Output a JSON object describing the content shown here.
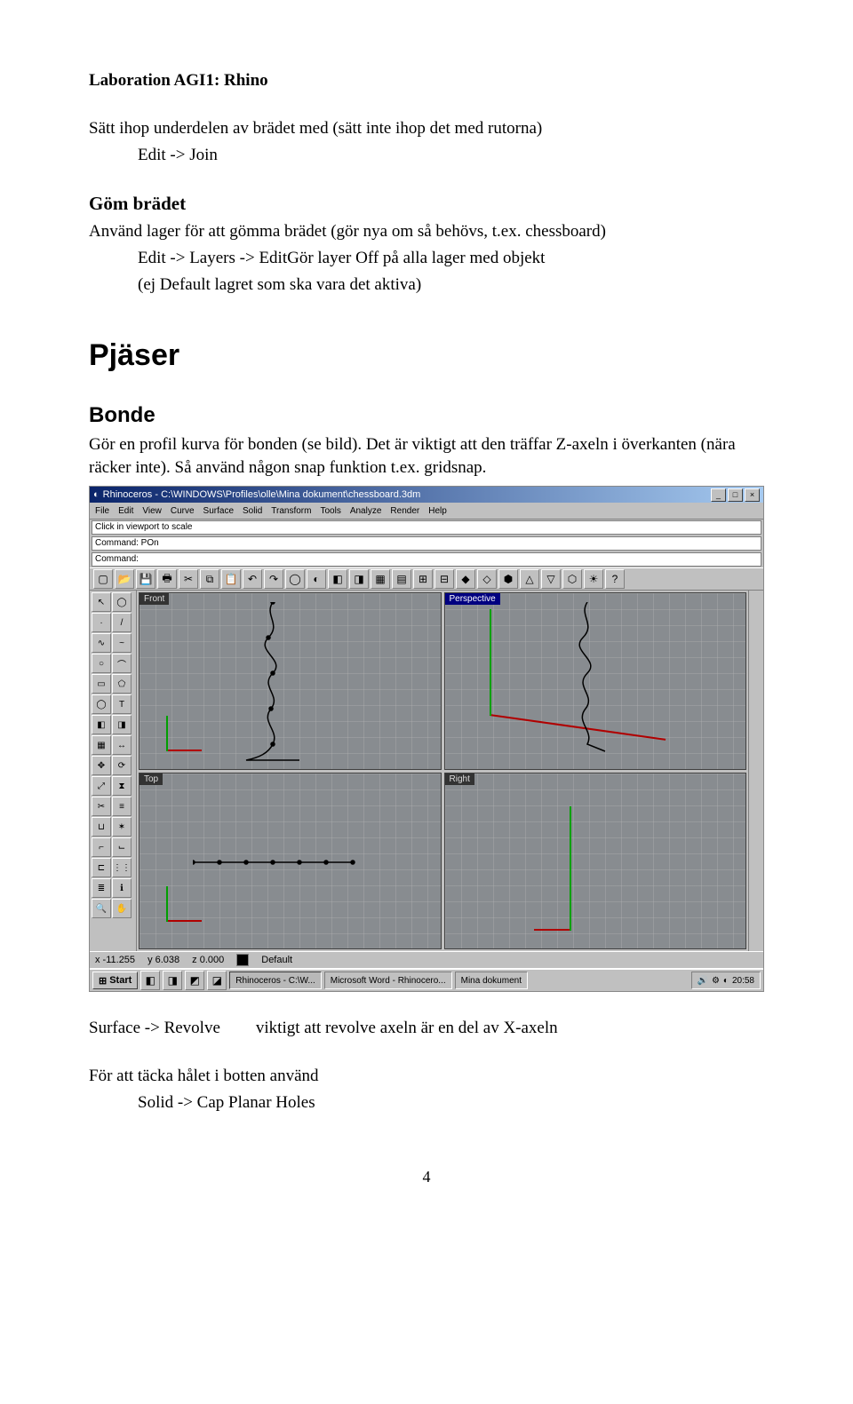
{
  "header": "Laboration AGI1:  Rhino",
  "p1": "Sätt ihop underdelen av brädet med (sätt inte ihop det med rutorna)",
  "p1_indent": "Edit -> Join",
  "h_gom": "Göm brädet",
  "p2a": "Använd lager för att gömma brädet (gör nya om så behövs, t.ex. chessboard)",
  "p2_indent1": "Edit -> Layers -> EditGör layer Off på alla lager med objekt",
  "p2_indent2": "(ej Default lagret som ska vara det aktiva)",
  "h_pjaser": "Pjäser",
  "h_bonde": "Bonde",
  "p3a": "Gör en profil kurva för bonden (se bild). Det är viktigt att den träffar Z-axeln i överkanten (nära räcker inte). Så använd någon snap funktion t.ex. gridsnap.",
  "rhino": {
    "title": "Rhinoceros - C:\\WINDOWS\\Profiles\\olle\\Mina dokument\\chessboard.3dm",
    "menus": [
      "File",
      "Edit",
      "View",
      "Curve",
      "Surface",
      "Solid",
      "Transform",
      "Tools",
      "Analyze",
      "Render",
      "Help"
    ],
    "cmd1": "Click in viewport to scale",
    "cmd2": "Command: POn",
    "cmd3": "Command:",
    "vp": {
      "front": "Front",
      "perspective": "Perspective",
      "top": "Top",
      "right": "Right"
    },
    "status": {
      "x": "x -11.255",
      "y": "y  6.038",
      "z": "z  0.000",
      "layer": "Default"
    },
    "task": {
      "start": "Start",
      "rhino": "Rhinoceros - C:\\W...",
      "word": "Microsoft Word - Rhinocero...",
      "doc": "Mina dokument",
      "clock": "20:58"
    }
  },
  "surface_label": "Surface -> Revolve",
  "surface_text": "viktigt att revolve axeln är en del av X-axeln",
  "p4": "För att täcka hålet i botten använd",
  "p4_indent": "Solid -> Cap Planar Holes",
  "page_num": "4"
}
